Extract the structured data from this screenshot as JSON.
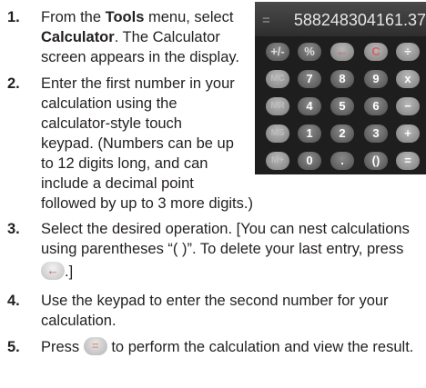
{
  "steps": [
    {
      "number": "1.",
      "lines": [
        [
          "From the ",
          "Tools",
          " menu, select"
        ],
        [
          "",
          "Calculator",
          ". The Calculator"
        ],
        [
          "screen appears in the display.",
          "",
          ""
        ]
      ]
    },
    {
      "number": "2.",
      "lines": [
        "Enter the first number in your",
        "calculation using the",
        "calculator-style touch",
        "keypad. (Numbers can be up",
        "to 12 digits long, and can",
        "include a decimal point",
        "followed by up to 3 more digits.)"
      ]
    },
    {
      "number": "3.",
      "lines": [
        "Select the desired operation. [You can nest calculations",
        "using parentheses  “( )”. To delete your last entry, press",
        ".]"
      ]
    },
    {
      "number": "4.",
      "lines": [
        "Use the keypad to enter the second number for your",
        "calculation."
      ]
    },
    {
      "number": "5.",
      "before": "Press ",
      "after": " to perform the calculation and view the result."
    }
  ],
  "calculator": {
    "display_equals": "=",
    "display_value": "588248304161.37",
    "keys": [
      [
        "+/-",
        "%",
        "←",
        "C",
        "÷"
      ],
      [
        "MC",
        "7",
        "8",
        "9",
        "x"
      ],
      [
        "MR",
        "4",
        "5",
        "6",
        "−"
      ],
      [
        "MS",
        "1",
        "2",
        "3",
        "+"
      ],
      [
        "M+",
        "0",
        ".",
        "()",
        "="
      ]
    ]
  },
  "icons": {
    "backspace": "←",
    "equals": "="
  }
}
